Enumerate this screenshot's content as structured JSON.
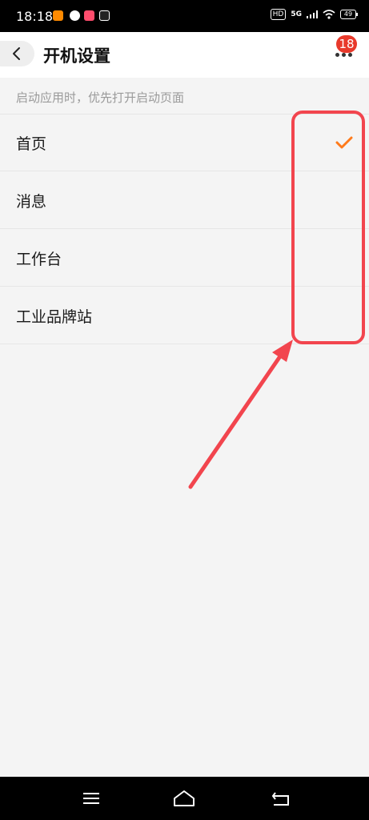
{
  "status_bar": {
    "time": "18:18",
    "hd": "HD",
    "network": "5G",
    "battery": "49"
  },
  "header": {
    "title": "开机设置",
    "badge_count": "18"
  },
  "hint": "启动应用时，优先打开启动页面",
  "options": [
    {
      "label": "首页",
      "selected": true
    },
    {
      "label": "消息",
      "selected": false
    },
    {
      "label": "工作台",
      "selected": false
    },
    {
      "label": "工业品牌站",
      "selected": false
    }
  ],
  "colors": {
    "accent": "#ff7a1a",
    "badge": "#e8392b",
    "annotation": "#f2454e"
  },
  "icons": {
    "back": "chevron-left-icon",
    "more": "more-dots-icon",
    "check": "check-icon",
    "nav_menu": "menu-icon",
    "nav_home": "home-icon",
    "nav_back": "return-icon"
  }
}
